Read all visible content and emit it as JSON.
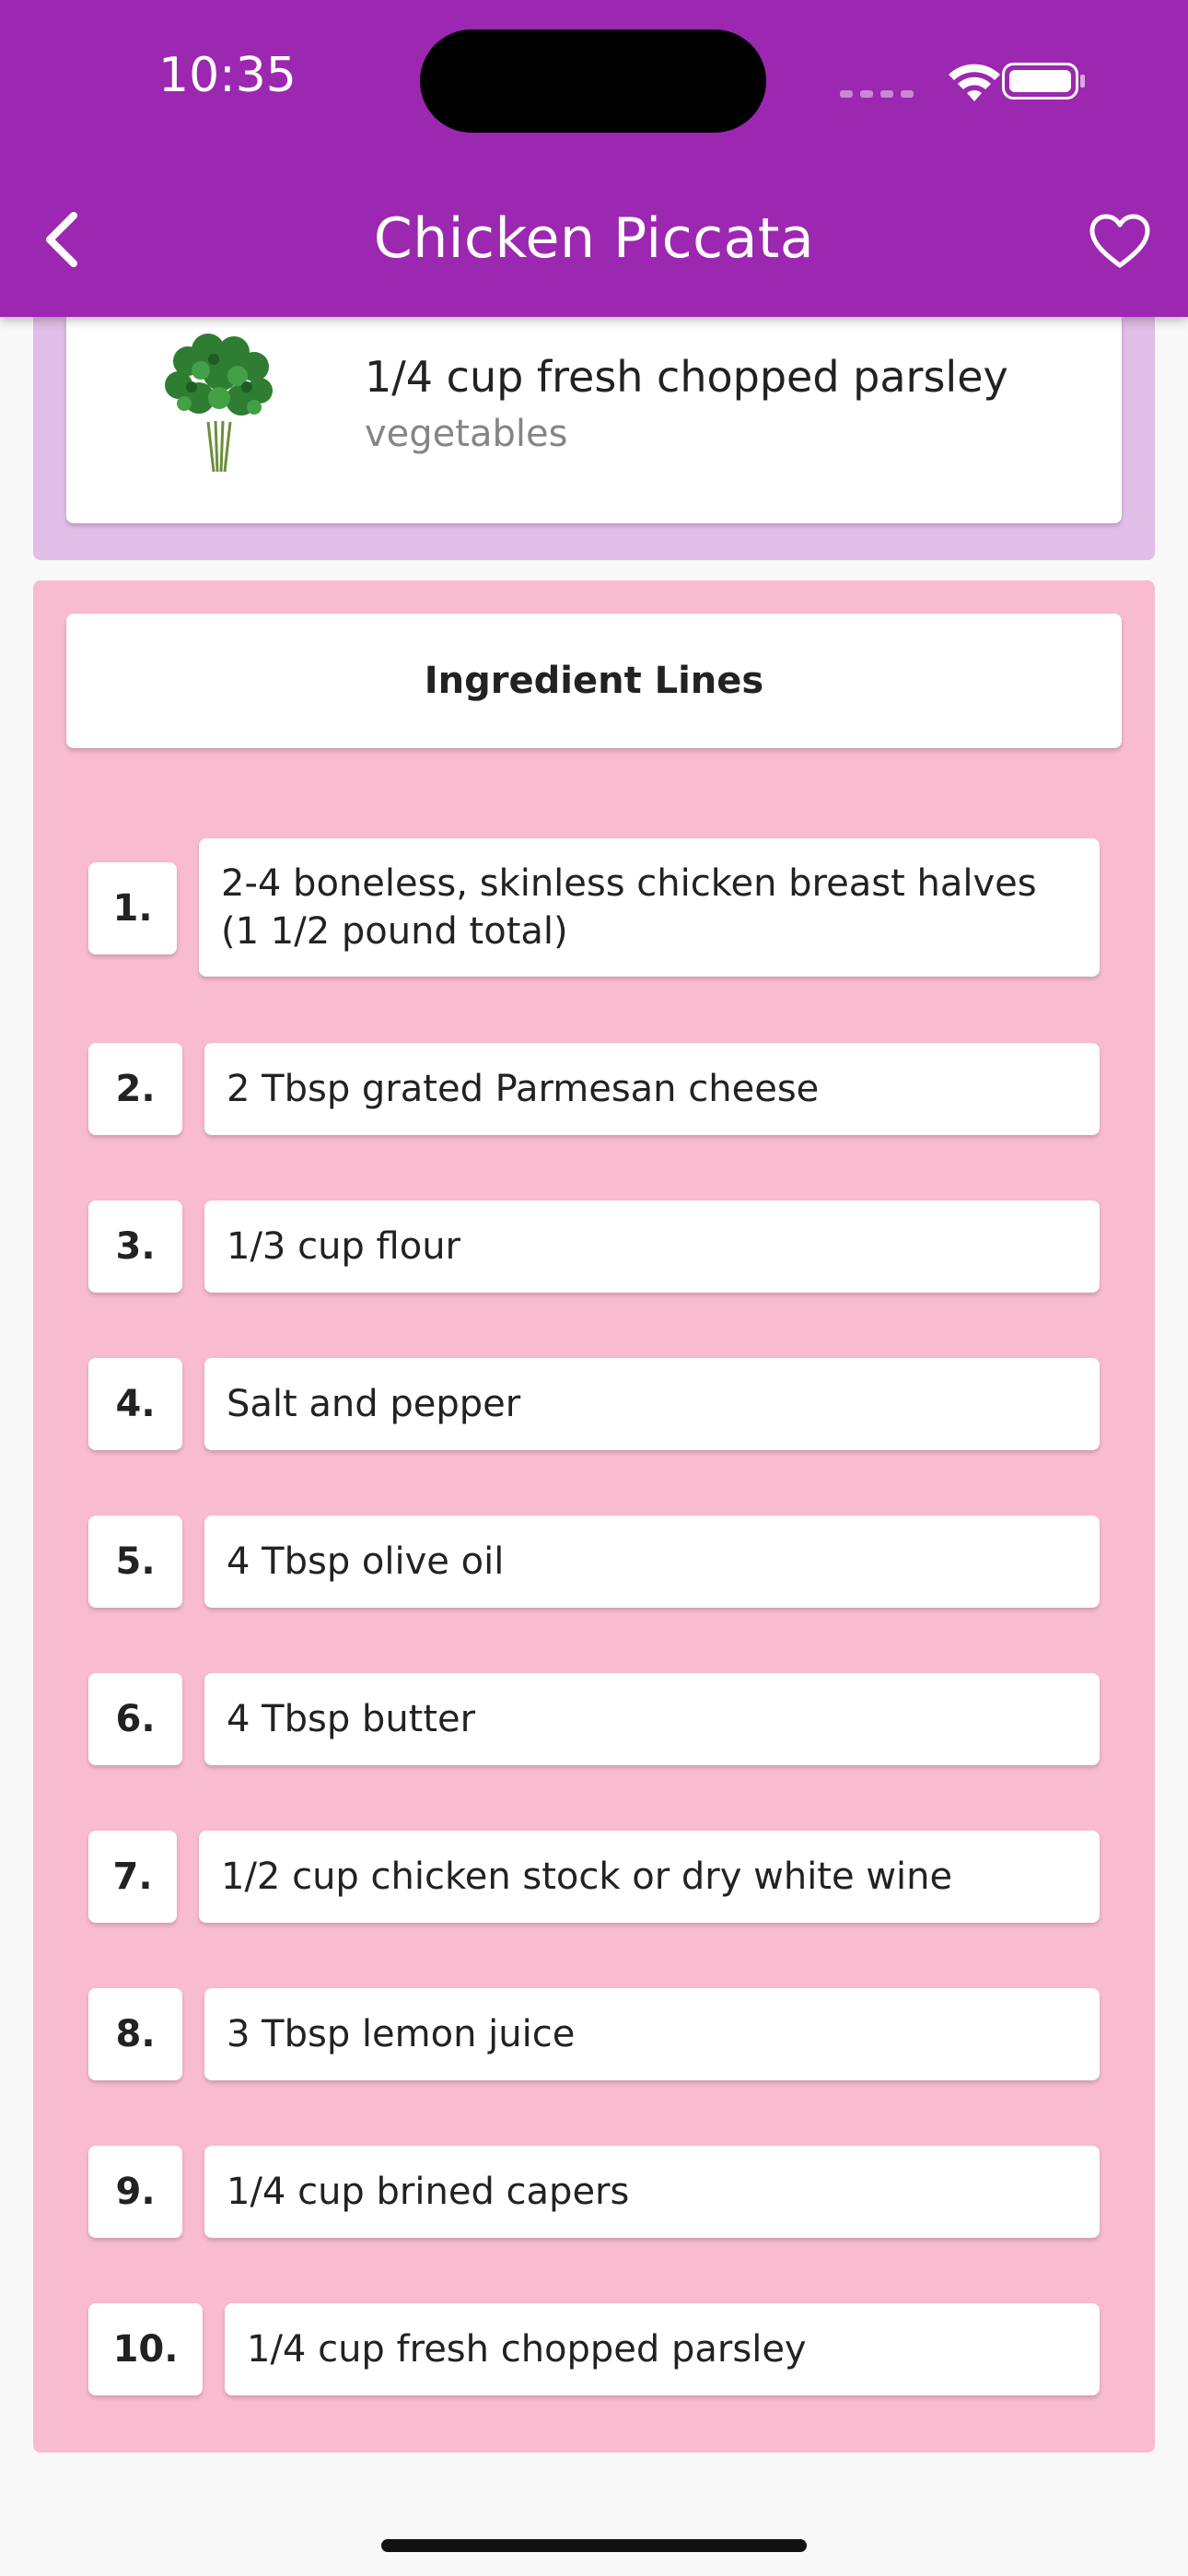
{
  "status_bar": {
    "time": "10:35"
  },
  "header": {
    "title": "Chicken Piccata",
    "back_icon": "chevron-left-icon",
    "favorite_icon": "heart-outline-icon"
  },
  "ingredient_card": {
    "name": "1/4 cup fresh chopped parsley",
    "category": "vegetables",
    "image": "parsley-image"
  },
  "ingredient_lines": {
    "heading": "Ingredient Lines",
    "items": [
      {
        "number": "1.",
        "text": "2-4 boneless, skinless chicken breast halves (1 1/2 pound total)"
      },
      {
        "number": "2.",
        "text": "2 Tbsp grated Parmesan cheese"
      },
      {
        "number": "3.",
        "text": "1/3 cup flour"
      },
      {
        "number": "4.",
        "text": "Salt and pepper"
      },
      {
        "number": "5.",
        "text": "4 Tbsp olive oil"
      },
      {
        "number": "6.",
        "text": "4 Tbsp butter"
      },
      {
        "number": "7.",
        "text": "1/2 cup chicken stock or dry white wine"
      },
      {
        "number": "8.",
        "text": "3 Tbsp lemon juice"
      },
      {
        "number": "9.",
        "text": "1/4 cup brined capers"
      },
      {
        "number": "10.",
        "text": "1/4 cup fresh chopped parsley"
      }
    ]
  },
  "colors": {
    "app_bar": "#9c27b0",
    "ingredients_section": "#e1bee7",
    "lines_section": "#f8bbd0",
    "card": "#ffffff"
  }
}
